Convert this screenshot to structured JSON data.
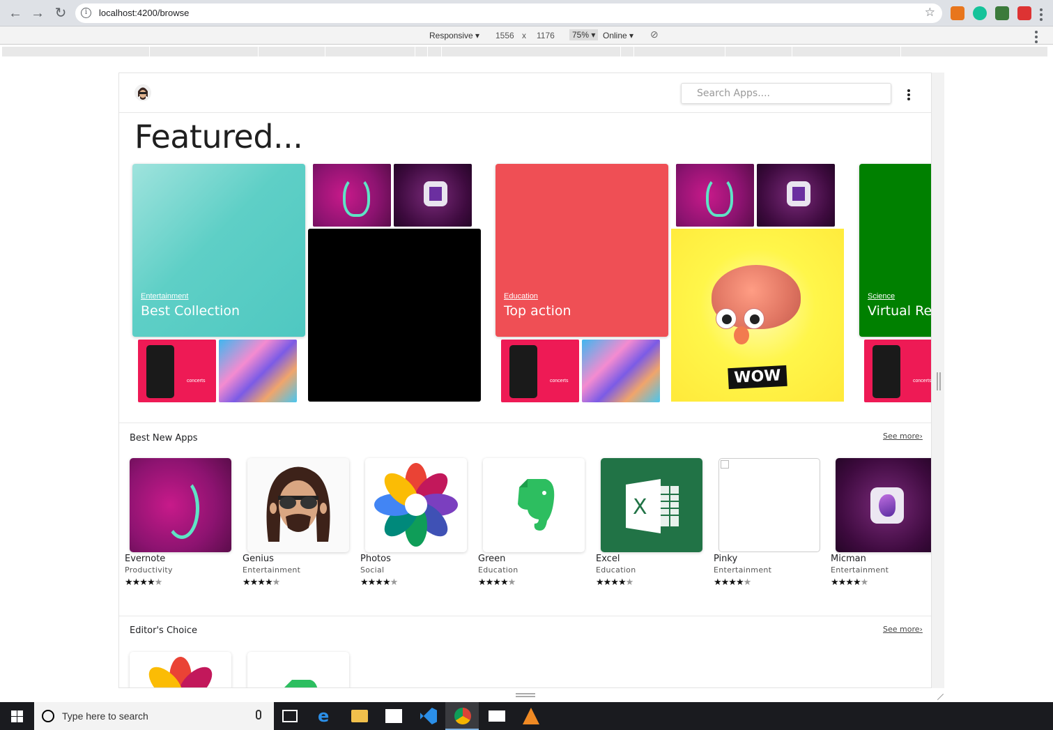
{
  "browser": {
    "url": "localhost:4200/browse",
    "device_mode": "Responsive",
    "width": "1556",
    "height": "1176",
    "times": "x",
    "zoom": "75%",
    "network": "Online"
  },
  "app": {
    "search_placeholder": "Search Apps....",
    "featured_title": "Featured..."
  },
  "featured_cards": [
    {
      "category": "Entertainment",
      "title": "Best Collection",
      "color": "#5ecfc6"
    },
    {
      "category": "Education",
      "title": "Top action",
      "color": "#ef4f55"
    },
    {
      "category": "Science",
      "title": "Virtual Rea",
      "color": "#008000"
    }
  ],
  "wow_text": "WOW",
  "sections": {
    "best_new": {
      "title": "Best New Apps",
      "see_more": "See more"
    },
    "editors_choice": {
      "title": "Editor's Choice",
      "see_more": "See more"
    }
  },
  "apps": [
    {
      "name": "Evernote",
      "category": "Productivity",
      "rating": 4
    },
    {
      "name": "Genius",
      "category": "Entertainment",
      "rating": 4
    },
    {
      "name": "Photos",
      "category": "Social",
      "rating": 4
    },
    {
      "name": "Green",
      "category": "Education",
      "rating": 4
    },
    {
      "name": "Excel",
      "category": "Education",
      "rating": 4
    },
    {
      "name": "Pinky",
      "category": "Entertainment",
      "rating": 4
    },
    {
      "name": "Micman",
      "category": "Entertainment",
      "rating": 4
    }
  ],
  "taskbar": {
    "search_placeholder": "Type here to search"
  }
}
